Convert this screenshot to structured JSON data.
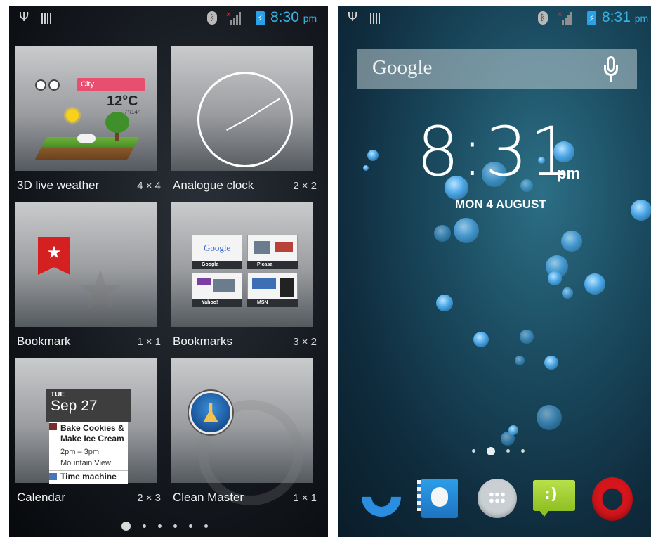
{
  "left_screen": {
    "status": {
      "time": "8:30",
      "ampm": "pm"
    },
    "widgets": [
      {
        "name": "3D live weather",
        "size": "4 × 4"
      },
      {
        "name": "Analogue clock",
        "size": "2 × 2"
      },
      {
        "name": "Bookmark",
        "size": "1 × 1"
      },
      {
        "name": "Bookmarks",
        "size": "3 × 2"
      },
      {
        "name": "Calendar",
        "size": "2 × 3"
      },
      {
        "name": "Clean Master",
        "size": "1 × 1"
      }
    ],
    "weather_preview": {
      "city": "City",
      "temp": "12°C",
      "range": "7°/14°"
    },
    "bookmarks_preview": [
      "Google",
      "Picasa",
      "Yahoo!",
      "MSN"
    ],
    "calendar_preview": {
      "dow": "TUE",
      "date": "Sep 27",
      "event1": "Bake Cookies & Make Ice Cream",
      "event1_time": "2pm – 3pm",
      "event1_location": "Mountain View",
      "event2": "Time machine"
    },
    "page_count": 6,
    "active_page": 0
  },
  "right_screen": {
    "status": {
      "time": "8:31",
      "ampm": "pm"
    },
    "search": {
      "logo": "Google"
    },
    "clock": {
      "time": "8:31",
      "ampm": "pm",
      "date": "MON 4 AUGUST"
    },
    "home_page_count": 4,
    "active_page": 1,
    "dock": [
      "phone-icon",
      "contacts-icon",
      "app-drawer-icon",
      "messaging-icon",
      "opera-icon"
    ]
  }
}
